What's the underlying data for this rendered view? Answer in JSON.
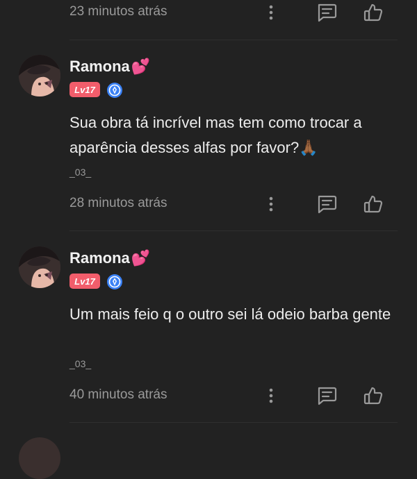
{
  "comments": [
    {
      "username": "Ramona",
      "username_emoji": "💕",
      "level": "Lv17",
      "text": "Sua obra tá incrível mas tem como trocar a aparência desses alfas por favor?🙏🏾",
      "signature": "_03_",
      "time": "28 minutos atrás"
    },
    {
      "username": "Ramona",
      "username_emoji": "💕",
      "level": "Lv17",
      "text": "Um mais feio q o outro sei lá odeio barba gente",
      "signature": "_03_",
      "time": "40 minutos atrás"
    }
  ],
  "prev_comment_time": "23 minutos atrás",
  "icons": {
    "more": "kebab-vertical-icon",
    "reply": "message-square-icon",
    "like": "thumbs-up-icon",
    "certified": "blue-certified-badge-icon"
  },
  "colors": {
    "background": "#222222",
    "level_badge": "#f25d6b",
    "certified_badge": "#3b82f6",
    "muted_text": "#9a9a9a"
  }
}
